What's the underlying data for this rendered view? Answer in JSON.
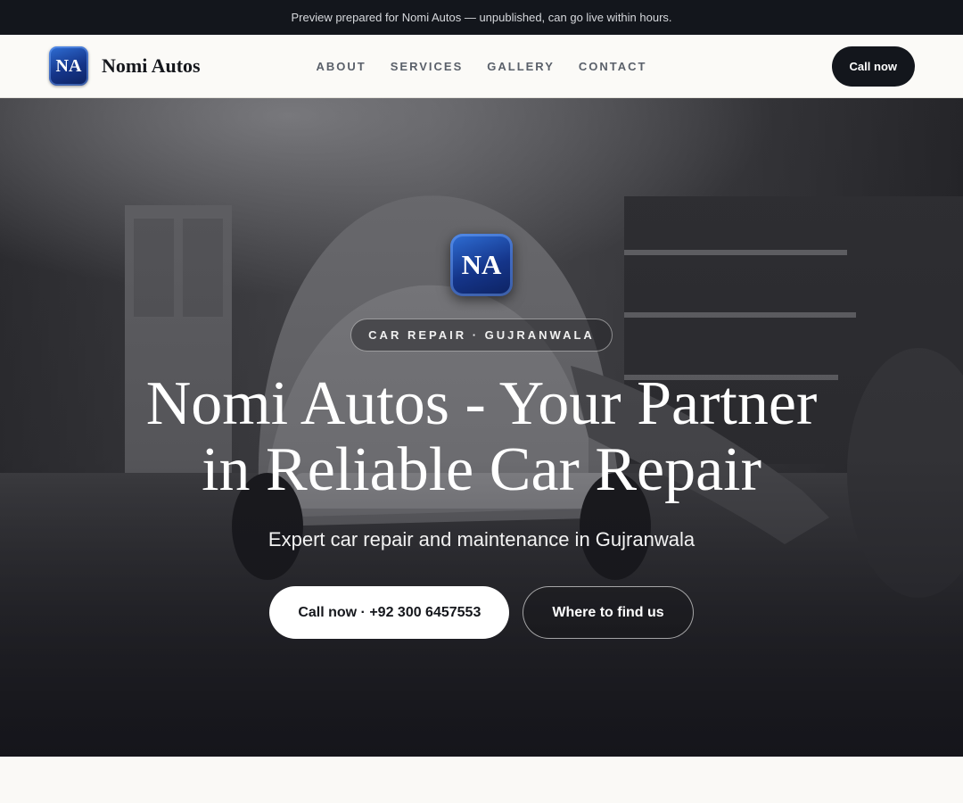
{
  "preview_banner": {
    "text": "Preview prepared for Nomi Autos — unpublished, can go live within hours."
  },
  "navbar": {
    "logo_initials": "NA",
    "brand_name": "Nomi Autos",
    "links": [
      "ABOUT",
      "SERVICES",
      "GALLERY",
      "CONTACT"
    ],
    "call_label": "Call now"
  },
  "hero": {
    "logo_initials": "NA",
    "tagline": "CAR REPAIR · GUJRANWALA",
    "title": "Nomi Autos - Your Partner in Reliable Car Repair",
    "subtitle": "Expert car repair and maintenance in Gujranwala",
    "primary_button": "Call now · +92 300 6457553",
    "secondary_button": "Where to find us",
    "background_description_icon": "garage-car-photo"
  },
  "colors": {
    "dark": "#13161c",
    "logo_blue": "#15358a",
    "page_bg": "#faf9f6"
  }
}
